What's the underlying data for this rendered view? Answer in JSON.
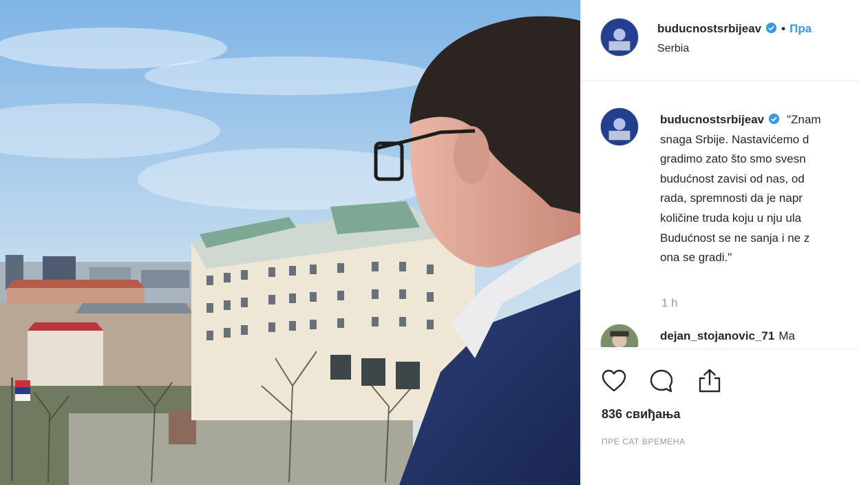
{
  "post": {
    "header": {
      "username": "buducnostsrbijeav",
      "follow_label": "Пра",
      "location": "Serbia",
      "avatar_icon": "profile-avatar-icon",
      "verified_icon": "verified-badge-icon"
    },
    "caption": {
      "username": "buducnostsrbijeav",
      "lines": [
        "\"Znam",
        "snaga Srbije. Nastavićemo d",
        "gradimo zato što smo svesn",
        "budućnost zavisi od nas, od",
        "rada, spremnosti da je napr",
        "količine truda koju u nju ula",
        "Budućnost se ne sanja i ne z",
        "ona se gradi.\""
      ],
      "time": "1 h"
    },
    "comment": {
      "username": "dejan_stojanovic_71",
      "text": "Ma"
    },
    "actions": {
      "like_icon": "heart-icon",
      "comment_icon": "comment-bubble-icon",
      "share_icon": "share-icon",
      "likes": "836 свиђања",
      "posted": "ПРЕ САТ ВРЕМЕНА"
    },
    "colors": {
      "link": "#3897f0",
      "text": "#262626",
      "muted": "#999999",
      "verified": "#3897f0"
    }
  }
}
